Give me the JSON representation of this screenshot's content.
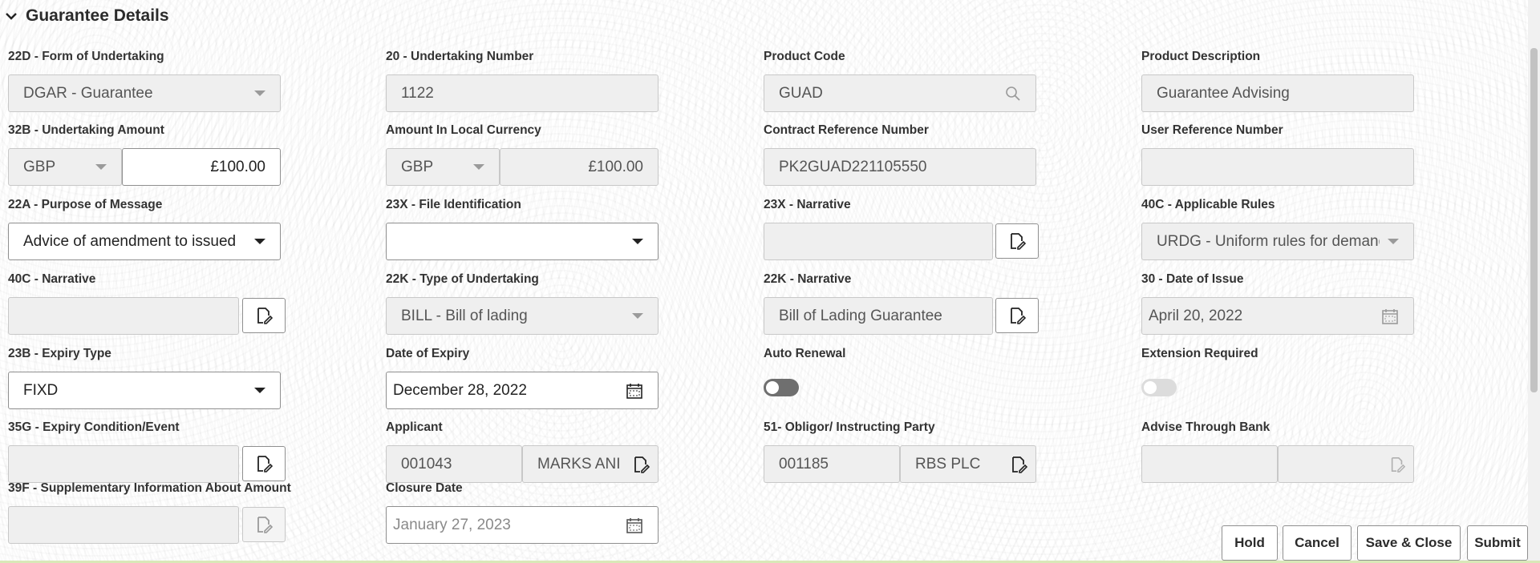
{
  "section": {
    "title": "Guarantee Details"
  },
  "fields": {
    "form_of_undertaking": {
      "label": "22D - Form of Undertaking",
      "value": "DGAR - Guarantee"
    },
    "undertaking_number": {
      "label": "20 - Undertaking Number",
      "value": "1122"
    },
    "product_code": {
      "label": "Product Code",
      "value": "GUAD"
    },
    "product_description": {
      "label": "Product Description",
      "value": "Guarantee Advising"
    },
    "undertaking_amount": {
      "label": "32B - Undertaking Amount",
      "currency": "GBP",
      "amount": "£100.00"
    },
    "amount_local_currency": {
      "label": "Amount In Local Currency",
      "currency": "GBP",
      "amount": "£100.00"
    },
    "contract_reference": {
      "label": "Contract Reference Number",
      "value": "PK2GUAD221105550"
    },
    "user_reference": {
      "label": "User Reference Number",
      "value": ""
    },
    "purpose_of_message": {
      "label": "22A - Purpose of Message",
      "value": "Advice of amendment to issued"
    },
    "file_identification": {
      "label": "23X - File Identification",
      "value": ""
    },
    "narrative_23x": {
      "label": "23X - Narrative",
      "value": ""
    },
    "applicable_rules": {
      "label": "40C - Applicable Rules",
      "value": "URDG - Uniform rules for demand"
    },
    "narrative_40c": {
      "label": "40C - Narrative",
      "value": ""
    },
    "type_of_undertaking": {
      "label": "22K - Type of Undertaking",
      "value": "BILL - Bill of lading"
    },
    "narrative_22k": {
      "label": "22K - Narrative",
      "value": "Bill of Lading Guarantee"
    },
    "date_of_issue": {
      "label": "30 - Date of Issue",
      "value": "April 20, 2022"
    },
    "expiry_type": {
      "label": "23B - Expiry Type",
      "value": "FIXD"
    },
    "date_of_expiry": {
      "label": "Date of Expiry",
      "value": "December 28, 2022"
    },
    "auto_renewal": {
      "label": "Auto Renewal"
    },
    "extension_required": {
      "label": "Extension Required"
    },
    "expiry_condition": {
      "label": "35G - Expiry Condition/Event",
      "value": ""
    },
    "applicant": {
      "label": "Applicant",
      "id": "001043",
      "name": "MARKS ANI"
    },
    "obligor": {
      "label": "51- Obligor/ Instructing Party",
      "id": "001185",
      "name": "RBS PLC"
    },
    "advise_through_bank": {
      "label": "Advise Through Bank",
      "id": "",
      "name": ""
    },
    "supplementary_info": {
      "label": "39F - Supplementary Information About Amount",
      "value": ""
    },
    "closure_date": {
      "label": "Closure Date",
      "value": "January 27, 2023"
    }
  },
  "footer": {
    "hold": "Hold",
    "cancel": "Cancel",
    "save_close": "Save & Close",
    "submit": "Submit"
  },
  "icons": {
    "collapse": "chevron-down-icon",
    "search": "search-icon",
    "edit": "edit-document-icon",
    "calendar": "calendar-icon"
  }
}
